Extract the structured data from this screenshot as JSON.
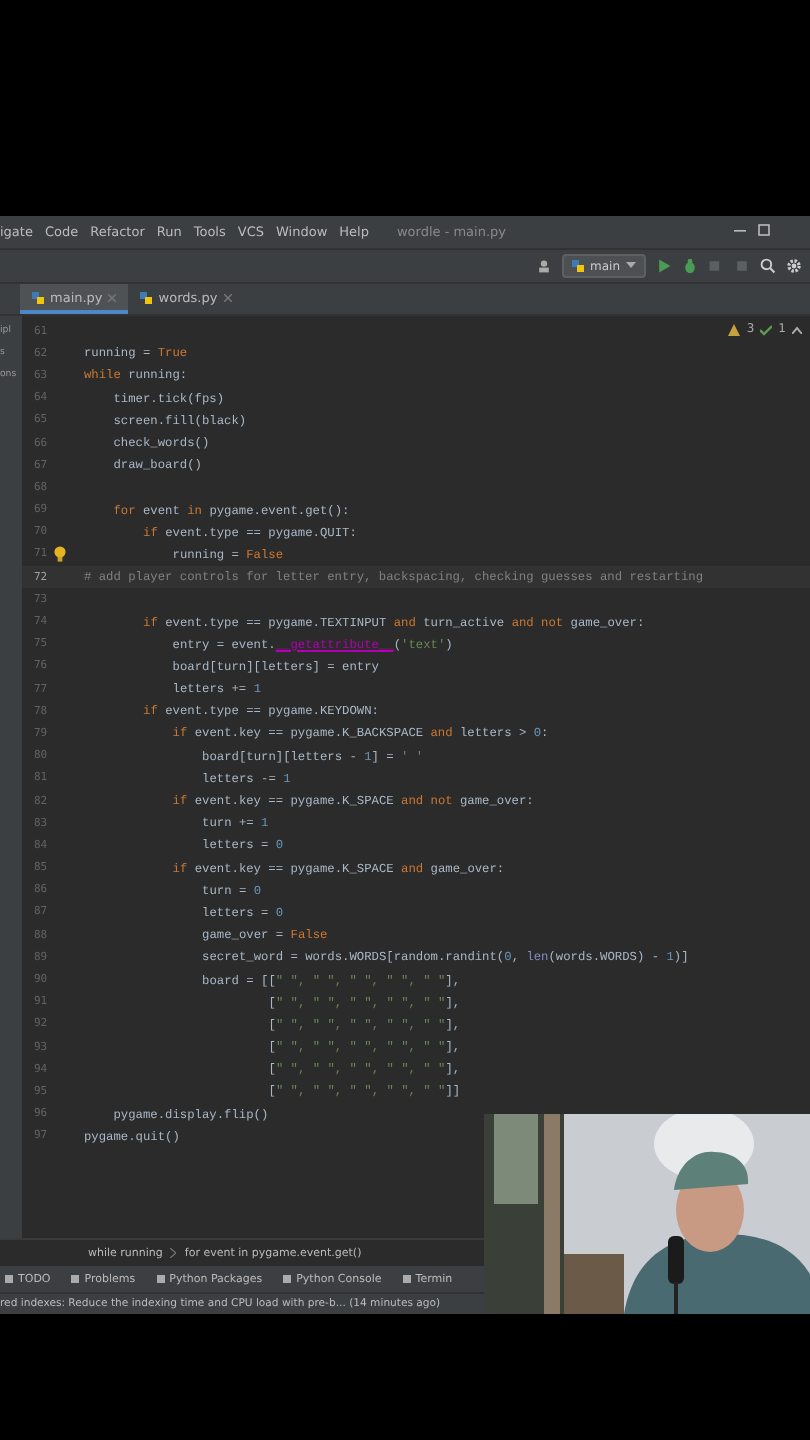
{
  "menu": {
    "items": [
      "igate",
      "Code",
      "Refactor",
      "Run",
      "Tools",
      "VCS",
      "Window",
      "Help"
    ],
    "title": "wordle - main.py"
  },
  "toolbar": {
    "run_config": "main"
  },
  "tabs": [
    {
      "label": "main.py",
      "selected": true
    },
    {
      "label": "words.py",
      "selected": false
    }
  ],
  "project_panel": [
    "ipl",
    "s",
    "ons"
  ],
  "inspections": {
    "warnings": "3",
    "checks": "1"
  },
  "editor": {
    "lines": [
      {
        "number": "61",
        "current": false
      },
      {
        "number": "62",
        "segments": [
          {
            "kind": "t",
            "text": "running = "
          },
          {
            "kind": "k",
            "text": "True"
          }
        ]
      },
      {
        "number": "63",
        "segments": [
          {
            "kind": "k",
            "text": "while "
          },
          {
            "kind": "t",
            "text": "running:"
          }
        ]
      },
      {
        "number": "64",
        "segments": [
          {
            "kind": "t",
            "text": "    timer.tick(fps)"
          }
        ]
      },
      {
        "number": "65",
        "segments": [
          {
            "kind": "t",
            "text": "    screen.fill(black)"
          }
        ]
      },
      {
        "number": "66",
        "segments": [
          {
            "kind": "t",
            "text": "    check_words()"
          }
        ]
      },
      {
        "number": "67",
        "segments": [
          {
            "kind": "t",
            "text": "    draw_board()"
          }
        ]
      },
      {
        "number": "68",
        "current": false
      },
      {
        "number": "69",
        "segments": [
          {
            "kind": "k",
            "text": "    for "
          },
          {
            "kind": "t",
            "text": "event "
          },
          {
            "kind": "k",
            "text": "in "
          },
          {
            "kind": "t",
            "text": "pygame.event.get():"
          }
        ]
      },
      {
        "number": "70",
        "segments": [
          {
            "kind": "k",
            "text": "        if "
          },
          {
            "kind": "t",
            "text": "event.type == pygame.QUIT:"
          }
        ]
      },
      {
        "number": "71",
        "bulb": true,
        "segments": [
          {
            "kind": "t",
            "text": "            running = "
          },
          {
            "kind": "k",
            "text": "False"
          }
        ]
      },
      {
        "number": "72",
        "current": true,
        "segments": [
          {
            "kind": "c",
            "text": "# add player controls for letter entry, backspacing, checking guesses and restarting"
          }
        ]
      },
      {
        "number": "73",
        "current": false
      },
      {
        "number": "74",
        "segments": [
          {
            "kind": "k",
            "text": "        if "
          },
          {
            "kind": "t",
            "text": "event.type == pygame.TEXTINPUT "
          },
          {
            "kind": "k",
            "text": "and "
          },
          {
            "kind": "t",
            "text": "turn_active "
          },
          {
            "kind": "k",
            "text": "and not "
          },
          {
            "kind": "t",
            "text": "game_over:"
          }
        ]
      },
      {
        "number": "75",
        "segments": [
          {
            "kind": "t",
            "text": "            entry = event."
          },
          {
            "kind": "m",
            "text": "__getattribute__"
          },
          {
            "kind": "t",
            "text": "("
          },
          {
            "kind": "s",
            "text": "'text'"
          },
          {
            "kind": "t",
            "text": ")"
          }
        ]
      },
      {
        "number": "76",
        "segments": [
          {
            "kind": "t",
            "text": "            board[turn][letters] = entry"
          }
        ]
      },
      {
        "number": "77",
        "segments": [
          {
            "kind": "t",
            "text": "            letters += "
          },
          {
            "kind": "n",
            "text": "1"
          }
        ]
      },
      {
        "number": "78",
        "segments": [
          {
            "kind": "k",
            "text": "        if "
          },
          {
            "kind": "t",
            "text": "event.type == pygame.KEYDOWN:"
          }
        ]
      },
      {
        "number": "79",
        "segments": [
          {
            "kind": "k",
            "text": "            if "
          },
          {
            "kind": "t",
            "text": "event.key == pygame.K_BACKSPACE "
          },
          {
            "kind": "k",
            "text": "and "
          },
          {
            "kind": "t",
            "text": "letters > "
          },
          {
            "kind": "n",
            "text": "0"
          },
          {
            "kind": "t",
            "text": ":"
          }
        ]
      },
      {
        "number": "80",
        "segments": [
          {
            "kind": "t",
            "text": "                board[turn][letters - "
          },
          {
            "kind": "n",
            "text": "1"
          },
          {
            "kind": "t",
            "text": "] = "
          },
          {
            "kind": "s",
            "text": "' '"
          }
        ]
      },
      {
        "number": "81",
        "segments": [
          {
            "kind": "t",
            "text": "                letters -= "
          },
          {
            "kind": "n",
            "text": "1"
          }
        ]
      },
      {
        "number": "82",
        "segments": [
          {
            "kind": "k",
            "text": "            if "
          },
          {
            "kind": "t",
            "text": "event.key == pygame.K_SPACE "
          },
          {
            "kind": "k",
            "text": "and not "
          },
          {
            "kind": "t",
            "text": "game_over:"
          }
        ]
      },
      {
        "number": "83",
        "segments": [
          {
            "kind": "t",
            "text": "                turn += "
          },
          {
            "kind": "n",
            "text": "1"
          }
        ]
      },
      {
        "number": "84",
        "segments": [
          {
            "kind": "t",
            "text": "                letters = "
          },
          {
            "kind": "n",
            "text": "0"
          }
        ]
      },
      {
        "number": "85",
        "segments": [
          {
            "kind": "k",
            "text": "            if "
          },
          {
            "kind": "t",
            "text": "event.key == pygame.K_SPACE "
          },
          {
            "kind": "k",
            "text": "and "
          },
          {
            "kind": "t",
            "text": "game_over:"
          }
        ]
      },
      {
        "number": "86",
        "segments": [
          {
            "kind": "t",
            "text": "                turn = "
          },
          {
            "kind": "n",
            "text": "0"
          }
        ]
      },
      {
        "number": "87",
        "segments": [
          {
            "kind": "t",
            "text": "                letters = "
          },
          {
            "kind": "n",
            "text": "0"
          }
        ]
      },
      {
        "number": "88",
        "segments": [
          {
            "kind": "t",
            "text": "                game_over = "
          },
          {
            "kind": "k",
            "text": "False"
          }
        ]
      },
      {
        "number": "89",
        "segments": [
          {
            "kind": "t",
            "text": "                secret_word = words.WORDS[random.randint("
          },
          {
            "kind": "n",
            "text": "0"
          },
          {
            "kind": "t",
            "text": ", "
          },
          {
            "kind": "f",
            "text": "len"
          },
          {
            "kind": "t",
            "text": "(words.WORDS) - "
          },
          {
            "kind": "n",
            "text": "1"
          },
          {
            "kind": "t",
            "text": ")]"
          }
        ]
      },
      {
        "number": "90",
        "segments": [
          {
            "kind": "t",
            "text": "                board = [["
          },
          {
            "kind": "s",
            "text": "\" \", \" \", \" \", \" \", \" \""
          },
          {
            "kind": "t",
            "text": "],"
          }
        ]
      },
      {
        "number": "91",
        "segments": [
          {
            "kind": "t",
            "text": "                         ["
          },
          {
            "kind": "s",
            "text": "\" \", \" \", \" \", \" \", \" \""
          },
          {
            "kind": "t",
            "text": "],"
          }
        ]
      },
      {
        "number": "92",
        "segments": [
          {
            "kind": "t",
            "text": "                         ["
          },
          {
            "kind": "s",
            "text": "\" \", \" \", \" \", \" \", \" \""
          },
          {
            "kind": "t",
            "text": "],"
          }
        ]
      },
      {
        "number": "93",
        "segments": [
          {
            "kind": "t",
            "text": "                         ["
          },
          {
            "kind": "s",
            "text": "\" \", \" \", \" \", \" \", \" \""
          },
          {
            "kind": "t",
            "text": "],"
          }
        ]
      },
      {
        "number": "94",
        "segments": [
          {
            "kind": "t",
            "text": "                         ["
          },
          {
            "kind": "s",
            "text": "\" \", \" \", \" \", \" \", \" \""
          },
          {
            "kind": "t",
            "text": "],"
          }
        ]
      },
      {
        "number": "95",
        "segments": [
          {
            "kind": "t",
            "text": "                         ["
          },
          {
            "kind": "s",
            "text": "\" \", \" \", \" \", \" \", \" \""
          },
          {
            "kind": "t",
            "text": "]]"
          }
        ]
      },
      {
        "number": "96",
        "segments": [
          {
            "kind": "t",
            "text": "    pygame.display.flip()"
          }
        ]
      },
      {
        "number": "97",
        "segments": [
          {
            "kind": "t",
            "text": "pygame.quit()"
          }
        ]
      }
    ]
  },
  "breadcrumbs": [
    "while running",
    "for event in pygame.event.get()"
  ],
  "tool_tabs": [
    "TODO",
    "Problems",
    "Python Packages",
    "Python Console",
    "Termin"
  ],
  "status": "red indexes: Reduce the indexing time and CPU load with pre-b... (14 minutes ago)",
  "webcam": {
    "kind": "picture"
  }
}
